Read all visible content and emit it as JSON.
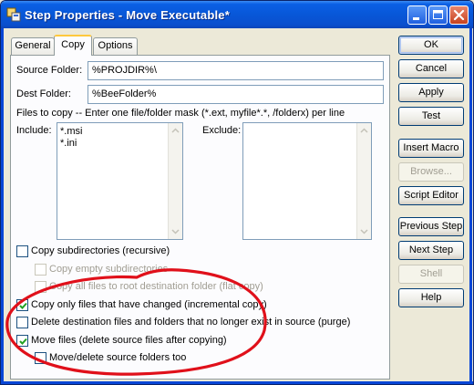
{
  "window": {
    "title": "Step Properties - Move Executable*"
  },
  "tabs": [
    {
      "label": "General",
      "active": false
    },
    {
      "label": "Copy",
      "active": true
    },
    {
      "label": "Options",
      "active": false
    }
  ],
  "copy": {
    "source_label": "Source Folder:",
    "source_value": "%PROJDIR%\\",
    "dest_label": "Dest Folder:",
    "dest_value": "%BeeFolder%",
    "files_hint": "Files to copy -- Enter one file/folder mask (*.ext, myfile*.*, /folderx) per line",
    "include_label": "Include:",
    "include_items": [
      "*.msi",
      "*.ini"
    ],
    "exclude_label": "Exclude:",
    "exclude_items": []
  },
  "options": [
    {
      "label": "Copy subdirectories (recursive)",
      "checked": false,
      "enabled": true
    },
    {
      "label": "Copy empty subdirectories",
      "checked": false,
      "enabled": false
    },
    {
      "label": "Copy all files to root destination folder (flat copy)",
      "checked": false,
      "enabled": false
    },
    {
      "label": "Copy only files that have changed (incremental copy)",
      "checked": true,
      "enabled": true
    },
    {
      "label": "Delete destination files and folders that no longer exist in source (purge)",
      "checked": false,
      "enabled": true
    },
    {
      "label": "Move files (delete source files after copying)",
      "checked": true,
      "enabled": true
    },
    {
      "label": "Move/delete source folders too",
      "checked": false,
      "enabled": true
    }
  ],
  "buttons": {
    "ok": "OK",
    "cancel": "Cancel",
    "apply": "Apply",
    "test": "Test",
    "insert_macro": "Insert Macro",
    "browse": "Browse...",
    "script_editor": "Script Editor",
    "previous_step": "Previous Step",
    "next_step": "Next Step",
    "shell": "Shell",
    "help": "Help"
  },
  "colors": {
    "title_bar": "#0a5fe4",
    "annotation": "#e0101a",
    "check": "#21a121"
  }
}
